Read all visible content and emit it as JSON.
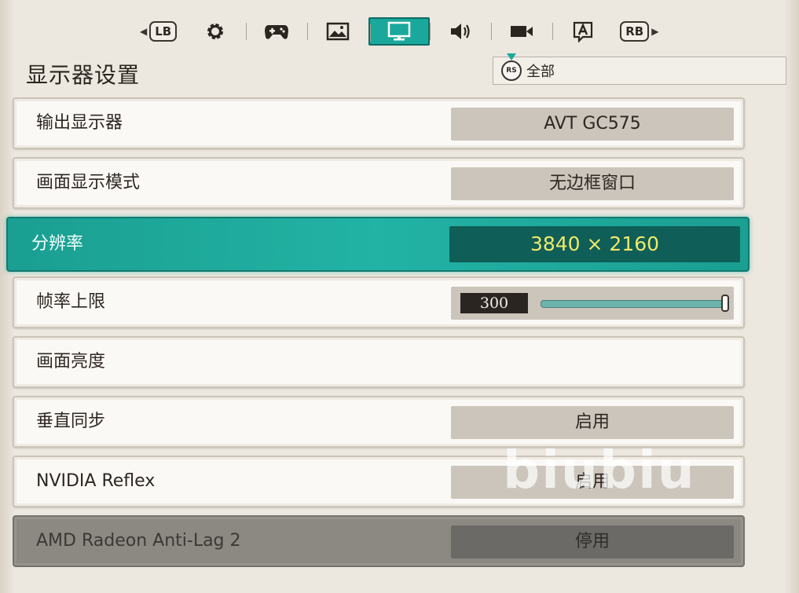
{
  "tabbar": {
    "left_button": "LB",
    "right_button": "RB",
    "tabs": [
      {
        "icon": "gear-icon"
      },
      {
        "icon": "gamepad-icon"
      },
      {
        "icon": "image-icon"
      },
      {
        "icon": "monitor-icon",
        "active": true
      },
      {
        "icon": "speaker-icon"
      },
      {
        "icon": "camera-icon"
      },
      {
        "icon": "text-a-icon"
      }
    ]
  },
  "page": {
    "title": "显示器设置"
  },
  "filter": {
    "button": "RS",
    "label": "全部"
  },
  "settings": [
    {
      "label": "输出显示器",
      "value": "AVT GC575"
    },
    {
      "label": "画面显示模式",
      "value": "无边框窗口"
    },
    {
      "label": "分辨率",
      "value": "3840 × 2160",
      "selected": true
    },
    {
      "label": "帧率上限",
      "value": "300",
      "slider_fraction": 1.0
    },
    {
      "label": "画面亮度",
      "value": ""
    },
    {
      "label": "垂直同步",
      "value": "启用"
    },
    {
      "label": "NVIDIA Reflex",
      "value": "启用"
    },
    {
      "label": "AMD Radeon Anti-Lag 2",
      "value": "停用",
      "disabled": true
    }
  ],
  "watermark": "biubiu",
  "colors": {
    "accent": "#1aa89c",
    "selected_value_text": "#f0e96a",
    "background": "#ece7df"
  }
}
